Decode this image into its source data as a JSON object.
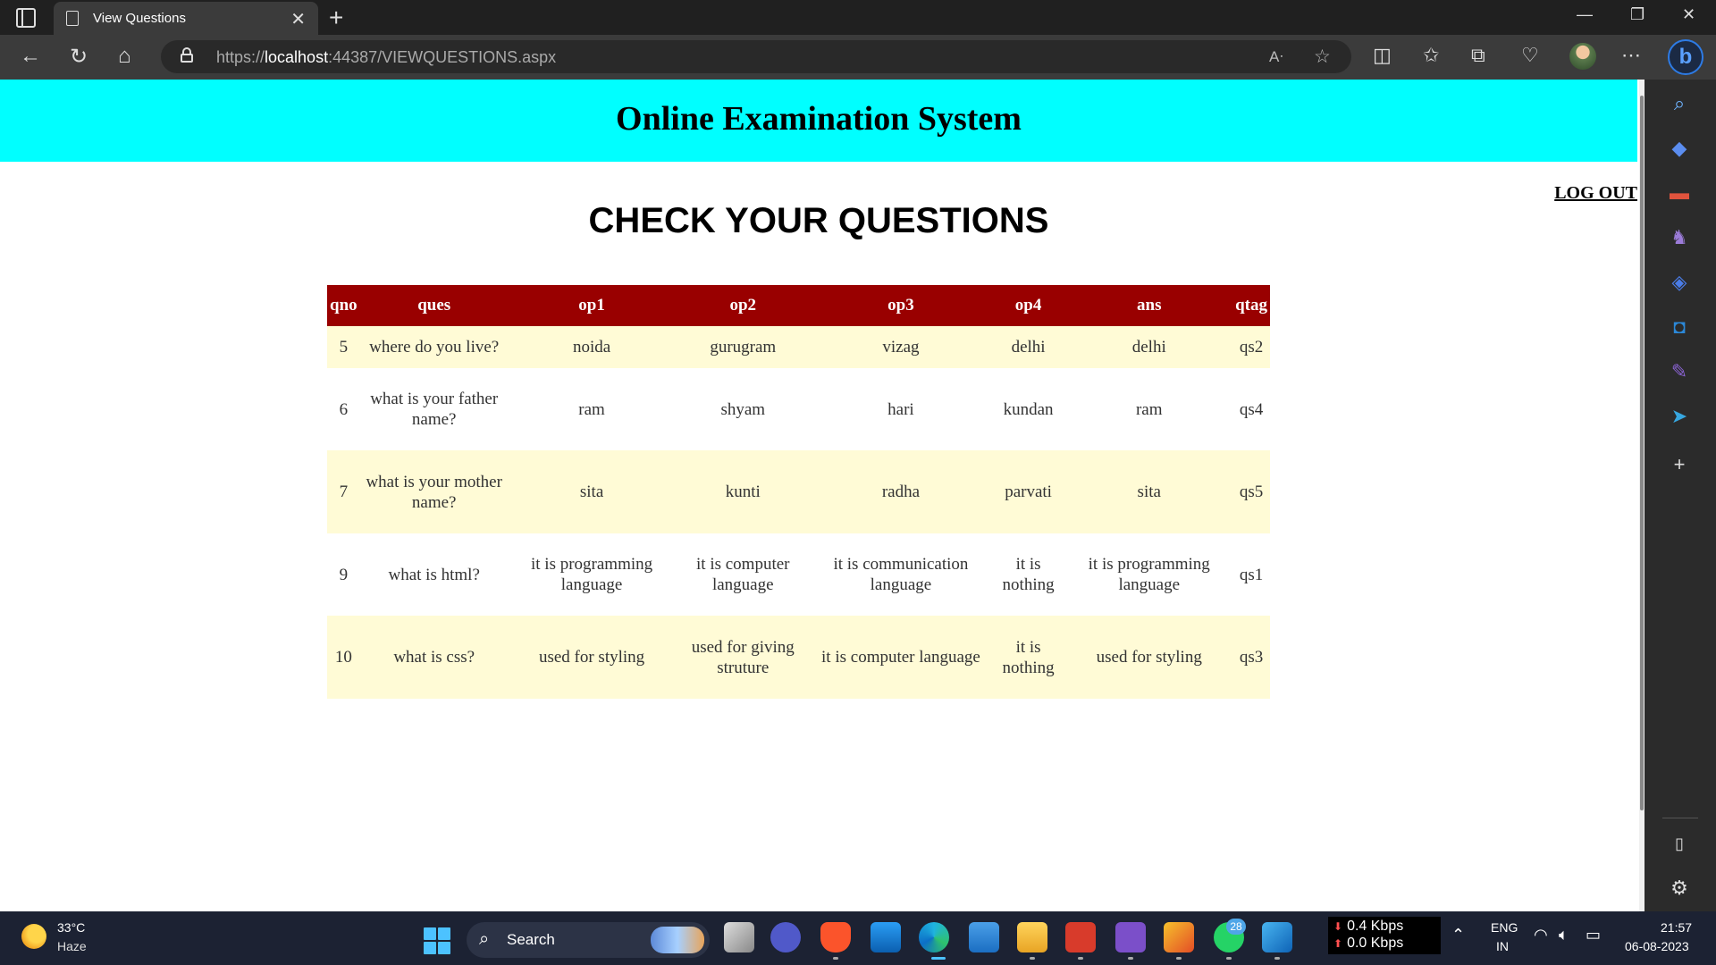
{
  "browser": {
    "tab_title": "View Questions",
    "tab_close": "✕",
    "new_tab": "+",
    "url_prefix": "https://",
    "url_host": "localhost",
    "url_rest": ":44387/VIEWQUESTIONS.aspx",
    "window_controls": {
      "minimize": "—",
      "restore": "❐",
      "close": "✕"
    }
  },
  "page": {
    "site_title": "Online Examination System",
    "logout_label": "LOG OUT",
    "heading": "CHECK YOUR QUESTIONS",
    "table": {
      "columns": [
        "qno",
        "ques",
        "op1",
        "op2",
        "op3",
        "op4",
        "ans",
        "qtag"
      ],
      "rows": [
        [
          "5",
          "where do you live?",
          "noida",
          "gurugram",
          "vizag",
          "delhi",
          "delhi",
          "qs2"
        ],
        [
          "6",
          "what is your father name?",
          "ram",
          "shyam",
          "hari",
          "kundan",
          "ram",
          "qs4"
        ],
        [
          "7",
          "what is your mother name?",
          "sita",
          "kunti",
          "radha",
          "parvati",
          "sita",
          "qs5"
        ],
        [
          "9",
          "what is html?",
          "it is programming language",
          "it is computer language",
          "it is communication language",
          "it is nothing",
          "it is programming language",
          "qs1"
        ],
        [
          "10",
          "what is css?",
          "used for styling",
          "used for giving struture",
          "it is computer language",
          "it is nothing",
          "used for styling",
          "qs3"
        ]
      ]
    }
  },
  "taskbar": {
    "weather_temp": "33°C",
    "weather_desc": "Haze",
    "search_label": "Search",
    "chat_badge": "28",
    "net_down": "0.4 Kbps",
    "net_up": "0.0 Kbps",
    "lang_line1": "ENG",
    "lang_line2": "IN",
    "time": "21:57",
    "date": "06-08-2023"
  }
}
